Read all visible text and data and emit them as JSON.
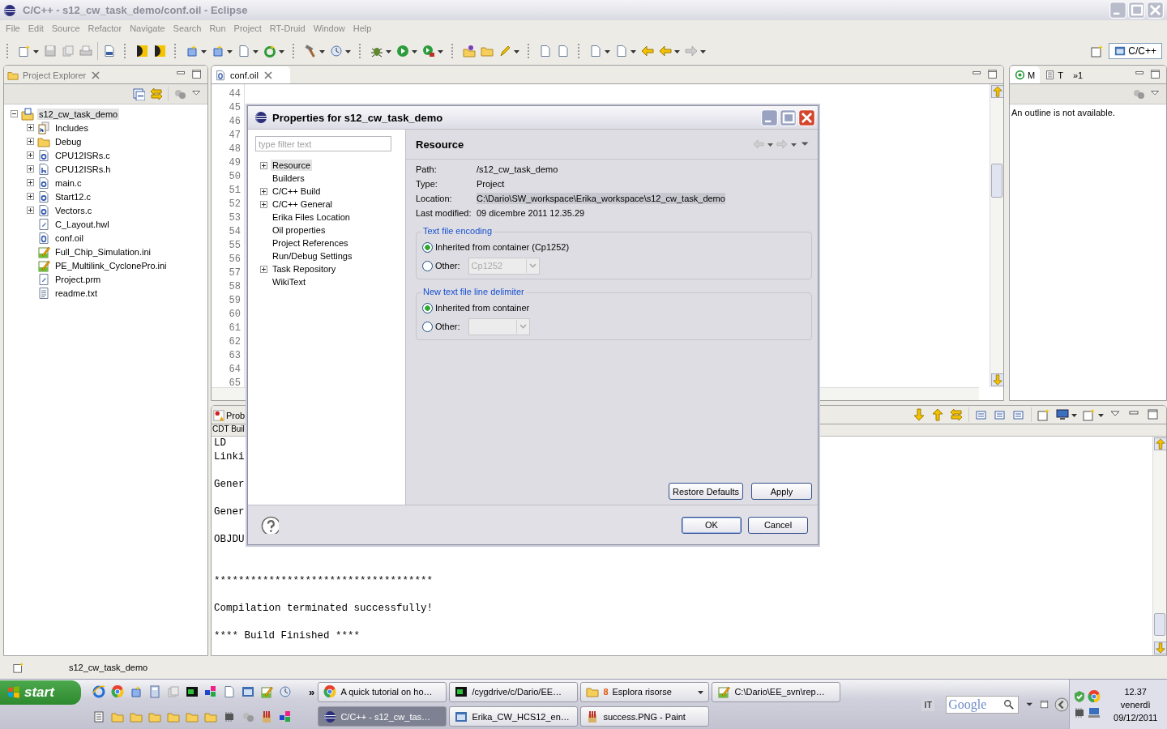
{
  "window": {
    "title": "C/C++ - s12_cw_task_demo/conf.oil - Eclipse"
  },
  "menu": [
    "File",
    "Edit",
    "Source",
    "Refactor",
    "Navigate",
    "Search",
    "Run",
    "Project",
    "RT-Druid",
    "Window",
    "Help"
  ],
  "perspective": {
    "label": "C/C++",
    "selected": true
  },
  "project_explorer": {
    "title": "Project Explorer",
    "tree": [
      {
        "label": "s12_cw_task_demo",
        "kind": "project",
        "expanded": true,
        "selected": true,
        "children": [
          {
            "label": "Includes",
            "kind": "library",
            "expanded": false,
            "selected": false
          },
          {
            "label": "Debug",
            "kind": "folder",
            "expanded": false,
            "selected": false
          },
          {
            "label": "CPU12ISRs.c",
            "kind": "source",
            "expanded": false,
            "selected": false
          },
          {
            "label": "CPU12ISRs.h",
            "kind": "header",
            "expanded": false,
            "selected": false
          },
          {
            "label": "main.c",
            "kind": "source",
            "expanded": false,
            "selected": false
          },
          {
            "label": "Start12.c",
            "kind": "source",
            "expanded": false,
            "selected": false
          },
          {
            "label": "Vectors.c",
            "kind": "source",
            "expanded": false,
            "selected": false
          },
          {
            "label": "C_Layout.hwl",
            "kind": "generic",
            "selected": false
          },
          {
            "label": "conf.oil",
            "kind": "oil",
            "selected": false
          },
          {
            "label": "Full_Chip_Simulation.ini",
            "kind": "notepad",
            "selected": false
          },
          {
            "label": "PE_Multilink_CyclonePro.ini",
            "kind": "notepad",
            "selected": false
          },
          {
            "label": "Project.prm",
            "kind": "generic",
            "selected": false
          },
          {
            "label": "readme.txt",
            "kind": "text",
            "selected": false
          }
        ]
      }
    ]
  },
  "editor": {
    "tab": "conf.oil",
    "line_numbers": [
      "44",
      "45",
      "46",
      "47",
      "48",
      "49",
      "50",
      "51",
      "52",
      "53",
      "54",
      "55",
      "56",
      "57",
      "58",
      "59",
      "60",
      "61",
      "62",
      "63",
      "64",
      "65"
    ]
  },
  "outline": {
    "tabs": [
      {
        "label": "M",
        "selected": true
      },
      {
        "label": "T",
        "selected": false
      },
      {
        "label": "»1",
        "selected": false
      }
    ],
    "message": "An outline is not available."
  },
  "console": {
    "tab": "Prob",
    "subtitle": "CDT Buil",
    "lines": [
      {
        "kind": "text",
        "text": "LD"
      },
      {
        "kind": "text",
        "text": "Linki"
      },
      {
        "kind": "blank"
      },
      {
        "kind": "text",
        "text": "Gener"
      },
      {
        "kind": "blank"
      },
      {
        "kind": "text",
        "text": "Gener"
      },
      {
        "kind": "blank"
      },
      {
        "kind": "text",
        "text": "OBJDU"
      },
      {
        "kind": "blank"
      },
      {
        "kind": "blank"
      },
      {
        "kind": "text",
        "text": "************************************"
      },
      {
        "kind": "blank"
      },
      {
        "kind": "text",
        "text": "Compilation terminated successfully!"
      },
      {
        "kind": "blank"
      },
      {
        "kind": "text",
        "text": "**** Build Finished ****"
      }
    ]
  },
  "dialog": {
    "title": "Properties for s12_cw_task_demo",
    "filter": {
      "placeholder": "type filter text"
    },
    "pages": [
      {
        "label": "Resource",
        "expanded": false,
        "selected": true
      },
      {
        "label": "Builders",
        "selected": false
      },
      {
        "label": "C/C++ Build",
        "expanded": false,
        "selected": false
      },
      {
        "label": "C/C++ General",
        "expanded": false,
        "selected": false
      },
      {
        "label": "Erika Files Location",
        "selected": false
      },
      {
        "label": "Oil properties",
        "selected": false
      },
      {
        "label": "Project References",
        "selected": false
      },
      {
        "label": "Run/Debug Settings",
        "selected": false
      },
      {
        "label": "Task Repository",
        "expanded": false,
        "selected": false
      },
      {
        "label": "WikiText",
        "selected": false
      }
    ],
    "page_title": "Resource",
    "fields": [
      {
        "label": "Path:",
        "value": "/s12_cw_task_demo",
        "selected": false
      },
      {
        "label": "Type:",
        "value": "Project",
        "selected": false
      },
      {
        "label": "Location:",
        "value": "C:\\Dario\\SW_workspace\\Erika_workspace\\s12_cw_task_demo",
        "selected": true
      },
      {
        "label": "Last modified:",
        "value": "09 dicembre 2011 12.35.29",
        "selected": false
      }
    ],
    "groups": [
      {
        "title": "Text file encoding",
        "options": [
          {
            "label": "Inherited from container (Cp1252)",
            "selected": true
          },
          {
            "label": "Other:",
            "selected": false,
            "combo": {
              "value": "Cp1252",
              "disabled": true
            }
          }
        ]
      },
      {
        "title": "New text file line delimiter",
        "options": [
          {
            "label": "Inherited from container",
            "selected": true
          },
          {
            "label": "Other:",
            "selected": false,
            "combo": {
              "disabled": true
            }
          }
        ]
      }
    ],
    "page_buttons": [
      "Restore Defaults",
      "Apply"
    ],
    "buttons": [
      {
        "label": "OK",
        "default": true
      },
      {
        "label": "Cancel",
        "default": false
      }
    ]
  },
  "status_bar": {
    "text": "s12_cw_task_demo"
  },
  "taskbar": {
    "start": "start",
    "more": "»",
    "rows": [
      [
        {
          "label": "A quick tutorial on ho…",
          "kind": "browser",
          "selected": false
        },
        {
          "label": "/cygdrive/c/Dario/EE…",
          "kind": "terminal",
          "selected": false
        },
        {
          "label": "Esplora risorse",
          "count": "8",
          "kind": "folder",
          "selected": false
        },
        {
          "label": "C:\\Dario\\EE_svn\\rep…",
          "kind": "notepad",
          "selected": false
        }
      ],
      [
        {
          "label": "C/C++ - s12_cw_tas…",
          "kind": "eclipse",
          "selected": true
        },
        {
          "label": "Erika_CW_HCS12_en…",
          "kind": "window",
          "selected": false
        },
        {
          "label": "success.PNG - Paint",
          "kind": "paint",
          "selected": false
        }
      ]
    ],
    "language": "IT",
    "search": {
      "placeholder": "Google"
    },
    "clock": {
      "time": "12.37",
      "day": "venerdì",
      "date": "09/12/2011"
    }
  }
}
